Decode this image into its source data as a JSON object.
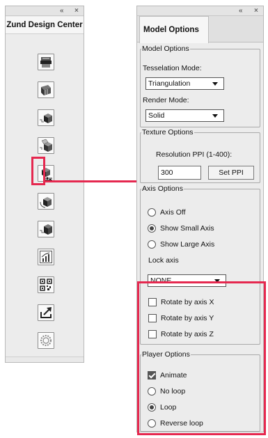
{
  "window_controls": {
    "collapse": "«",
    "close": "×"
  },
  "left_panel": {
    "title": "Zund Design Center",
    "tools": [
      {
        "name": "printer-tool"
      },
      {
        "name": "cutting-mat-tool"
      },
      {
        "name": "box-front-tool"
      },
      {
        "name": "box-open-tool"
      },
      {
        "name": "model-options-tool"
      },
      {
        "name": "box-rotate-tool"
      },
      {
        "name": "box-fold-tool"
      },
      {
        "name": "chart-tool"
      },
      {
        "name": "qr-code-tool"
      },
      {
        "name": "export-tool"
      },
      {
        "name": "settings-tool"
      }
    ]
  },
  "right_panel": {
    "tab": "Model Options",
    "model_options": {
      "legend": "Model Options",
      "tesselation_label": "Tesselation Mode:",
      "tesselation_value": "Triangulation",
      "render_label": "Render Mode:",
      "render_value": "Solid"
    },
    "texture_options": {
      "legend": "Texture Options",
      "resolution_label": "Resolution PPI (1-400):",
      "resolution_value": "300",
      "set_button": "Set PPI"
    },
    "axis_options": {
      "legend": "Axis Options",
      "radios": [
        {
          "label": "Axis Off",
          "selected": false
        },
        {
          "label": "Show Small Axis",
          "selected": true
        },
        {
          "label": "Show Large Axis",
          "selected": false
        }
      ],
      "lock_label": "Lock axis",
      "lock_value": "NONE",
      "rotate": [
        {
          "label": "Rotate by axis X",
          "checked": false
        },
        {
          "label": "Rotate by axis Y",
          "checked": false
        },
        {
          "label": "Rotate by axis Z",
          "checked": false
        }
      ]
    },
    "player_options": {
      "legend": "Player Options",
      "animate": {
        "label": "Animate",
        "checked": true
      },
      "radios": [
        {
          "label": "No loop",
          "selected": false
        },
        {
          "label": "Loop",
          "selected": true
        },
        {
          "label": "Reverse loop",
          "selected": false
        }
      ]
    }
  },
  "colors": {
    "highlight": "#e5284f",
    "panel": "#ececec"
  }
}
